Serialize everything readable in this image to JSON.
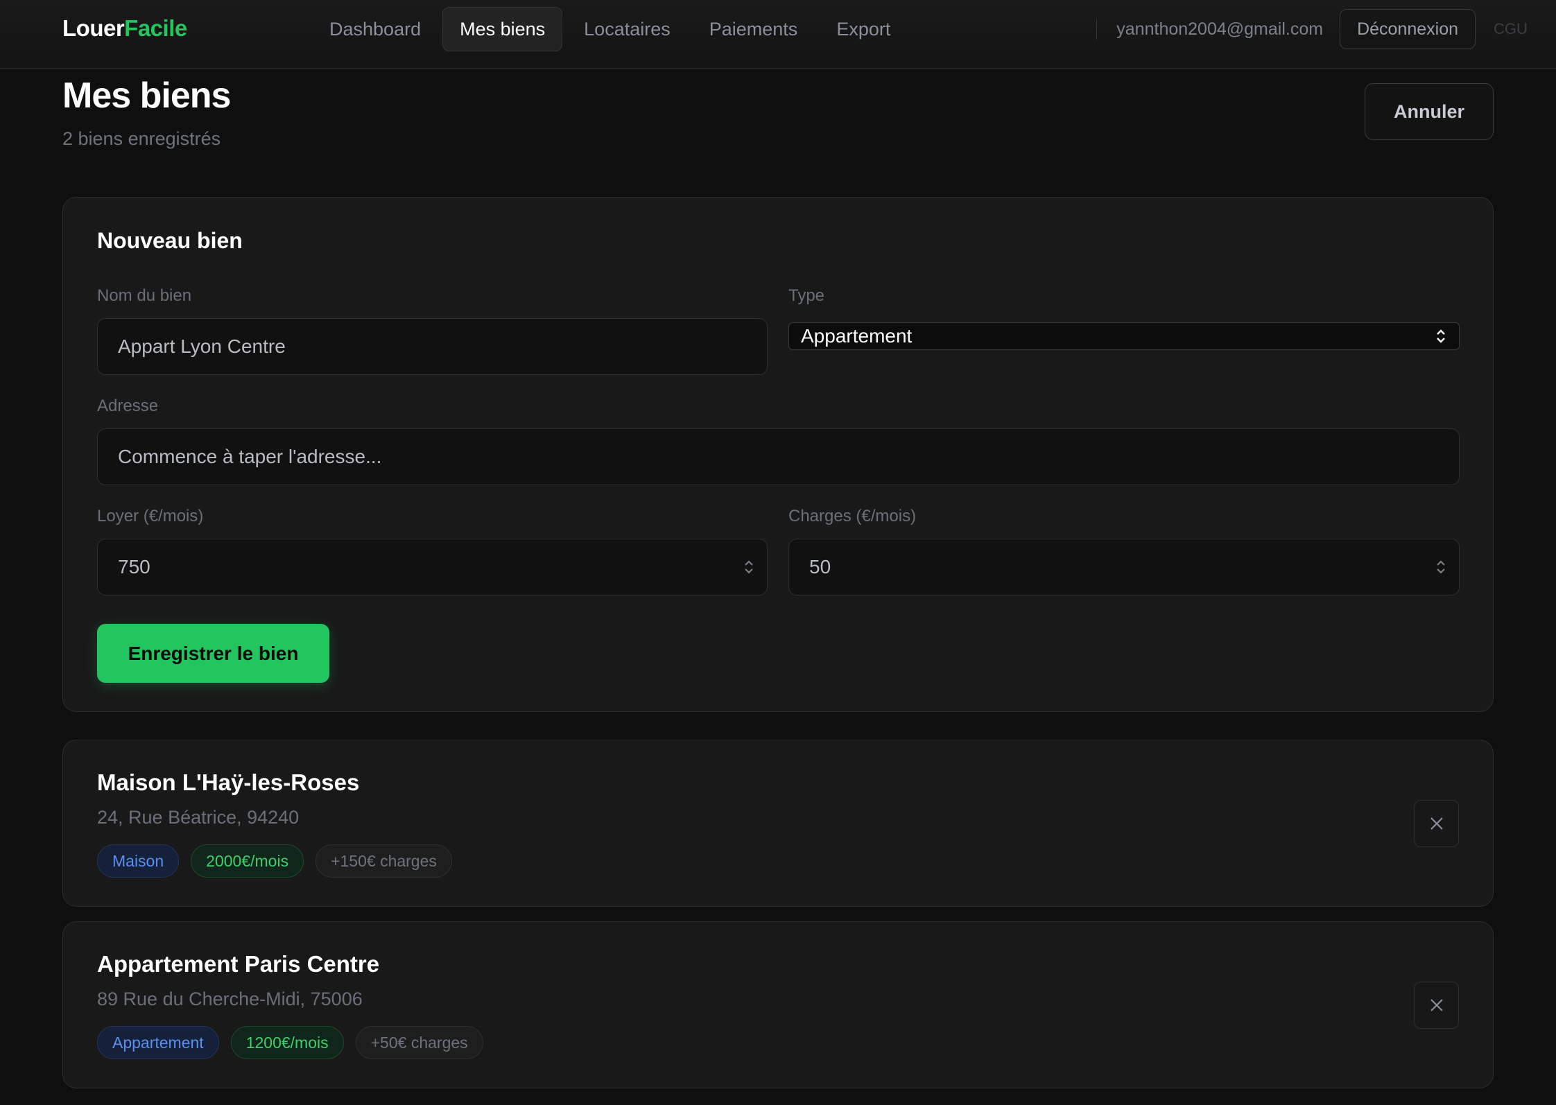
{
  "brand": {
    "part1": "Louer",
    "part2": "Facile"
  },
  "nav": {
    "items": [
      {
        "label": "Dashboard",
        "active": false
      },
      {
        "label": "Mes biens",
        "active": true
      },
      {
        "label": "Locataires",
        "active": false
      },
      {
        "label": "Paiements",
        "active": false
      },
      {
        "label": "Export",
        "active": false
      }
    ],
    "email": "yannthon2004@gmail.com",
    "logout_label": "Déconnexion",
    "cgu_label": "CGU"
  },
  "page": {
    "title": "Mes biens",
    "subtitle": "2 biens enregistrés",
    "cancel_label": "Annuler"
  },
  "form": {
    "title": "Nouveau bien",
    "name_label": "Nom du bien",
    "name_placeholder": "Appart Lyon Centre",
    "type_label": "Type",
    "type_value": "Appartement",
    "address_label": "Adresse",
    "address_placeholder": "Commence à taper l'adresse...",
    "rent_label": "Loyer (€/mois)",
    "rent_value": "750",
    "charges_label": "Charges (€/mois)",
    "charges_value": "50",
    "submit_label": "Enregistrer le bien"
  },
  "properties": [
    {
      "name": "Maison L'Haÿ-les-Roses",
      "address": "24, Rue Béatrice, 94240",
      "type": "Maison",
      "rent": "2000€/mois",
      "charges": "+150€ charges"
    },
    {
      "name": "Appartement Paris Centre",
      "address": "89 Rue du Cherche-Midi, 75006",
      "type": "Appartement",
      "rent": "1200€/mois",
      "charges": "+50€ charges"
    }
  ],
  "colors": {
    "accent": "#22c55e",
    "background": "#0f0f0f",
    "card": "#191919",
    "type_tag": "#5a8ff0"
  }
}
